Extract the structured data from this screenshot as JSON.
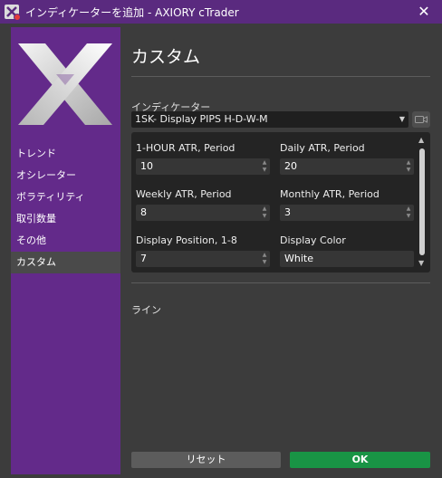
{
  "window": {
    "title": "インディケーターを追加 - AXIORY cTrader",
    "close_glyph": "✕"
  },
  "sidebar": {
    "items": [
      {
        "label": "トレンド",
        "active": false
      },
      {
        "label": "オシレーター",
        "active": false
      },
      {
        "label": "ボラティリティ",
        "active": false
      },
      {
        "label": "取引数量",
        "active": false
      },
      {
        "label": "その他",
        "active": false
      },
      {
        "label": "カスタム",
        "active": true
      }
    ]
  },
  "main": {
    "title": "カスタム",
    "indicator_label": "インディケーター",
    "indicator_selected": "1SK- Display PIPS  H-D-W-M",
    "params": [
      {
        "label": "1-HOUR ATR, Period",
        "value": "10",
        "type": "number"
      },
      {
        "label": "Daily ATR, Period",
        "value": "20",
        "type": "number"
      },
      {
        "label": "Weekly ATR, Period",
        "value": "8",
        "type": "number"
      },
      {
        "label": "Monthly ATR, Period",
        "value": "3",
        "type": "number"
      },
      {
        "label": "Display Position, 1-8",
        "value": "7",
        "type": "number"
      },
      {
        "label": "Display Color",
        "value": "White",
        "type": "text"
      }
    ],
    "line_label": "ライン"
  },
  "buttons": {
    "reset_label": "リセット",
    "ok_label": "OK"
  },
  "icons": {
    "app": "axiory-ctrader-icon",
    "logo": "axiory-x-logo",
    "camera": "camera-icon",
    "dropdown": "chevron-down-icon",
    "spinner_up": "spin-up-icon",
    "spinner_down": "spin-down-icon"
  },
  "colors": {
    "titlebar": "#5a2a7f",
    "sidebar": "#632a8a",
    "background": "#3c3c3c",
    "panel": "#242424",
    "ok_button": "#199445",
    "reset_button": "#5c5c5c"
  }
}
